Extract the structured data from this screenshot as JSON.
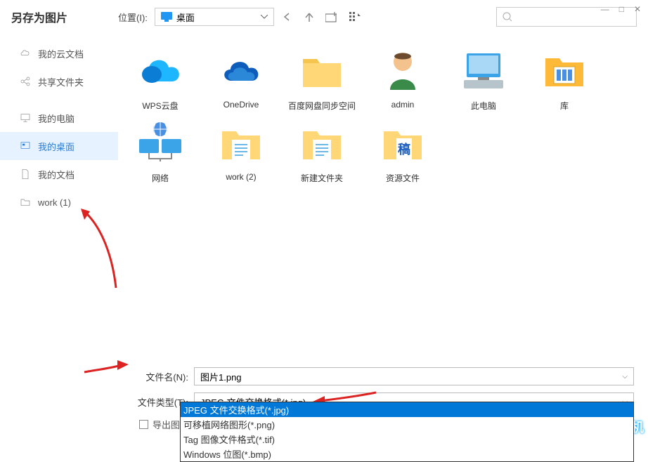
{
  "window": {
    "title": "另存为图片"
  },
  "location": {
    "label": "位置(I):",
    "value": "桌面"
  },
  "search": {
    "placeholder": ""
  },
  "sidebar": {
    "items": [
      {
        "label": "我的云文档",
        "icon": "cloud"
      },
      {
        "label": "共享文件夹",
        "icon": "share"
      },
      {
        "label": "我的电脑",
        "icon": "computer"
      },
      {
        "label": "我的桌面",
        "icon": "desktop",
        "active": true
      },
      {
        "label": "我的文档",
        "icon": "doc"
      },
      {
        "label": "work (1)",
        "icon": "folder"
      }
    ]
  },
  "grid": {
    "items": [
      {
        "label": "WPS云盘",
        "type": "wps"
      },
      {
        "label": "OneDrive",
        "type": "onedrive"
      },
      {
        "label": "百度网盘同步空间",
        "type": "folder"
      },
      {
        "label": "admin",
        "type": "user"
      },
      {
        "label": "此电脑",
        "type": "pc"
      },
      {
        "label": "库",
        "type": "lib"
      },
      {
        "label": "网络",
        "type": "net"
      },
      {
        "label": "work (2)",
        "type": "folder-doc"
      },
      {
        "label": "新建文件夹",
        "type": "folder-doc"
      },
      {
        "label": "资源文件",
        "type": "folder-gao"
      }
    ]
  },
  "form": {
    "filename_label": "文件名(N):",
    "filename_value": "图片1.png",
    "filetype_label": "文件类型(T):",
    "filetype_value": "JPEG 文件交换格式(*.jpg)",
    "export_label": "导出图片后自"
  },
  "dropdown_options": [
    "JPEG 文件交换格式(*.jpg)",
    "可移植网络图形(*.png)",
    "Tag 图像文件格式(*.tif)",
    "Windows 位图(*.bmp)"
  ],
  "watermark": {
    "text": "好装机"
  }
}
